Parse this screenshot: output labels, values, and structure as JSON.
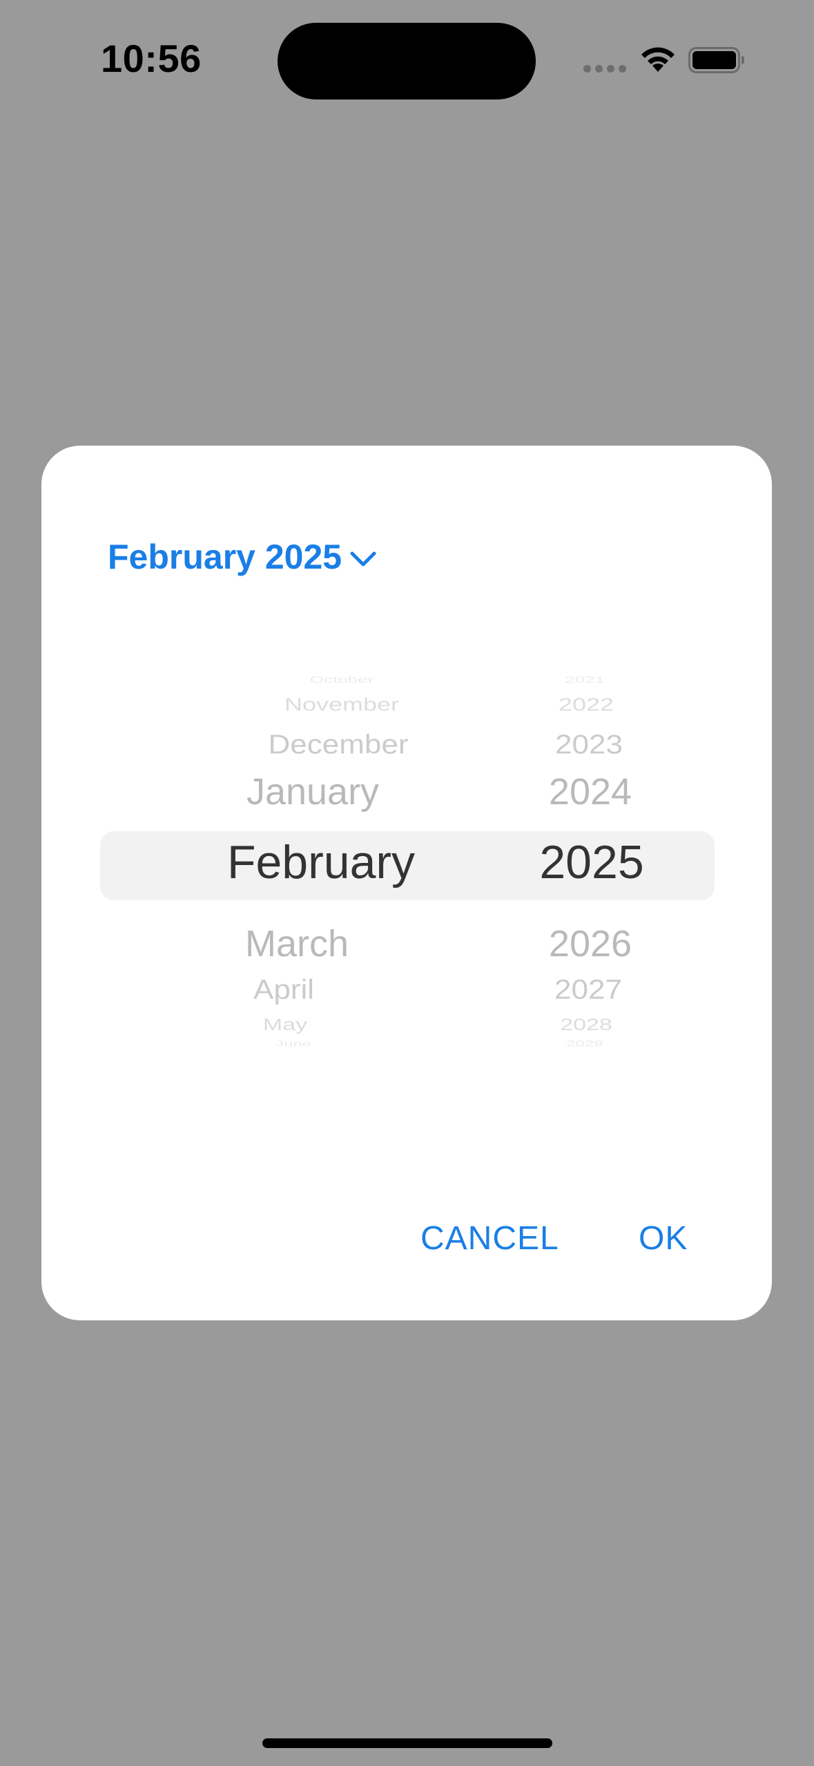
{
  "status_bar": {
    "time": "10:56",
    "icons": [
      "signal-icon",
      "wifi-icon",
      "battery-icon"
    ]
  },
  "dialog": {
    "header_label": "February 2025",
    "header_icon": "chevron-down-icon",
    "picker": {
      "months": [
        "October",
        "November",
        "December",
        "January",
        "February",
        "March",
        "April",
        "May",
        "June"
      ],
      "years": [
        "2021",
        "2022",
        "2023",
        "2024",
        "2025",
        "2026",
        "2027",
        "2028",
        "2029"
      ],
      "selected_month": "February",
      "selected_year": "2025"
    },
    "buttons": {
      "cancel": "CANCEL",
      "ok": "OK"
    }
  },
  "colors": {
    "accent": "#1a7ee6",
    "scrim": "#9a9a9a",
    "selected_text": "#333333",
    "unselected_text": "#a6a6a6",
    "highlight": "#f2f2f2"
  }
}
